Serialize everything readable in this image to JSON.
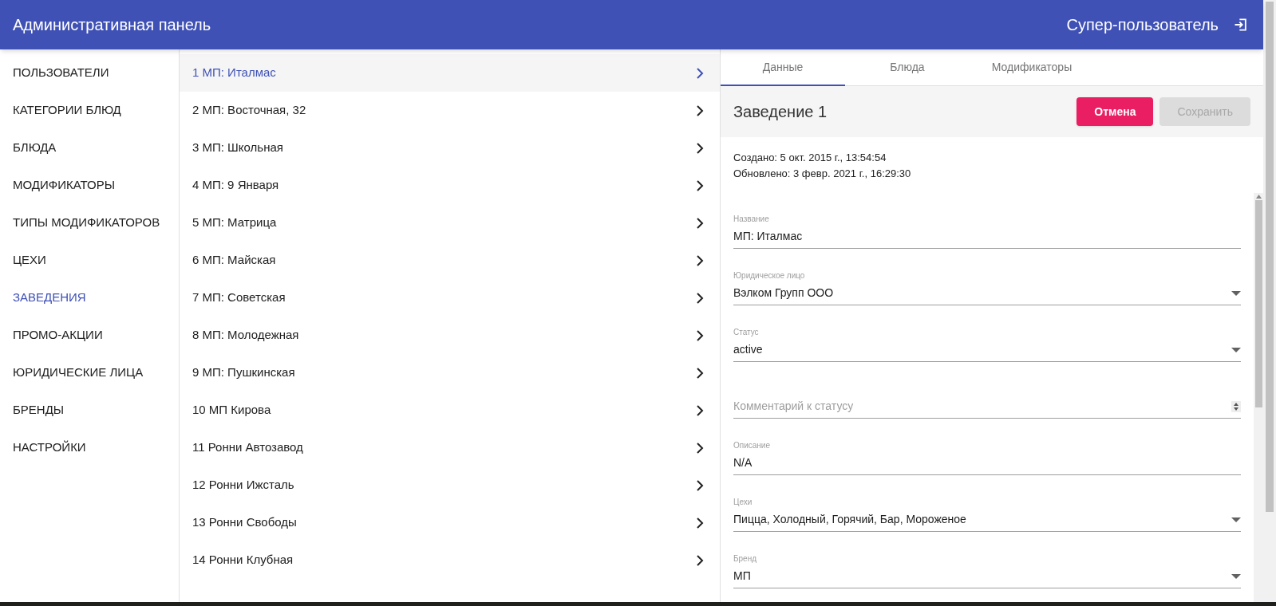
{
  "header": {
    "title": "Административная панель",
    "user": "Супер-пользователь"
  },
  "sidebar": {
    "items": [
      {
        "label": "ПОЛЬЗОВАТЕЛИ",
        "selected": false
      },
      {
        "label": "КАТЕГОРИИ БЛЮД",
        "selected": false
      },
      {
        "label": "БЛЮДА",
        "selected": false
      },
      {
        "label": "МОДИФИКАТОРЫ",
        "selected": false
      },
      {
        "label": "ТИПЫ МОДИФИКАТОРОВ",
        "selected": false
      },
      {
        "label": "ЦЕХИ",
        "selected": false
      },
      {
        "label": "ЗАВЕДЕНИЯ",
        "selected": true
      },
      {
        "label": "ПРОМО-АКЦИИ",
        "selected": false
      },
      {
        "label": "ЮРИДИЧЕСКИЕ ЛИЦА",
        "selected": false
      },
      {
        "label": "БРЕНДЫ",
        "selected": false
      },
      {
        "label": "НАСТРОЙКИ",
        "selected": false
      }
    ]
  },
  "list": {
    "items": [
      {
        "label": "1 МП: Италмас",
        "selected": true
      },
      {
        "label": "2 МП: Восточная, 32",
        "selected": false
      },
      {
        "label": "3 МП: Школьная",
        "selected": false
      },
      {
        "label": "4 МП: 9 Января",
        "selected": false
      },
      {
        "label": "5 МП: Матрица",
        "selected": false
      },
      {
        "label": "6 МП: Майская",
        "selected": false
      },
      {
        "label": "7 МП: Советская",
        "selected": false
      },
      {
        "label": "8 МП: Молодежная",
        "selected": false
      },
      {
        "label": "9 МП: Пушкинская",
        "selected": false
      },
      {
        "label": "10 МП Кирова",
        "selected": false
      },
      {
        "label": "11 Ронни Автозавод",
        "selected": false
      },
      {
        "label": "12 Ронни Ижсталь",
        "selected": false
      },
      {
        "label": "13 Ронни Свободы",
        "selected": false
      },
      {
        "label": "14 Ронни Клубная",
        "selected": false
      }
    ]
  },
  "detail": {
    "tabs": [
      {
        "label": "Данные",
        "selected": true
      },
      {
        "label": "Блюда",
        "selected": false
      },
      {
        "label": "Модификаторы",
        "selected": false
      }
    ],
    "title": "Заведение 1",
    "buttons": [
      {
        "label": "Отмена",
        "disabled": false
      },
      {
        "label": "Сохранить",
        "disabled": true
      }
    ],
    "meta": [
      "Создано: 5 окт. 2015 г., 13:54:54",
      "Обновлено: 3 февр. 2021 г., 16:29:30"
    ],
    "fields": [
      {
        "kind": "text",
        "label": "Название",
        "value": "МП: Италмас"
      },
      {
        "kind": "select",
        "label": "Юридическое лицо",
        "value": "Вэлком Групп ООО"
      },
      {
        "kind": "select",
        "label": "Статус",
        "value": "active"
      },
      {
        "kind": "textarea",
        "placeholder": "Комментарий к статусу"
      },
      {
        "kind": "text",
        "label": "Описание",
        "value": "N/A"
      },
      {
        "kind": "select",
        "label": "Цехи",
        "value": "Пицца, Холодный, Горячий, Бар, Мороженое"
      },
      {
        "kind": "select",
        "label": "Бренд",
        "value": "МП"
      }
    ]
  }
}
